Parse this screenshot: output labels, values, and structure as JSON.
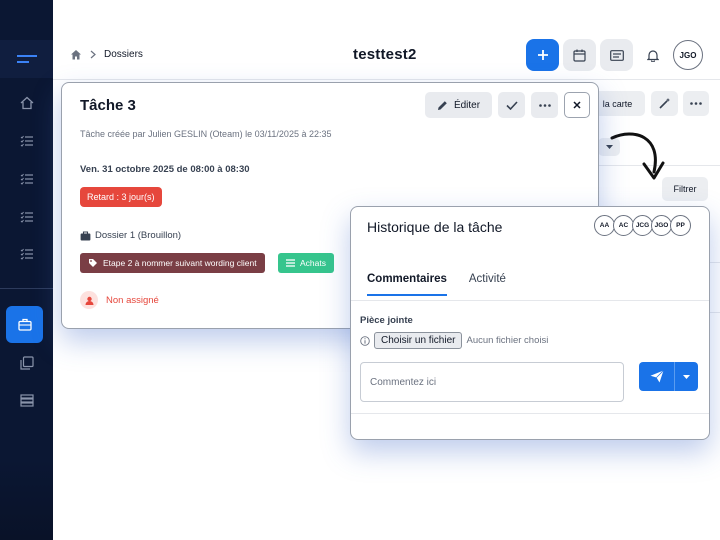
{
  "header": {
    "breadcrumb": "Dossiers",
    "title": "testtest2",
    "avatar": "JGO"
  },
  "background": {
    "card_button": "la carte",
    "filter_button": "Filtrer"
  },
  "task": {
    "title": "Tâche 3",
    "edit_label": "Éditer",
    "created": "Tâche créée par Julien GESLIN (Oteam) le 03/11/2025 à 22:35",
    "date": "Ven. 31 octobre 2025 de 08:00 à 08:30",
    "late_badge": "Retard : 3 jour(s)",
    "folder": "Dossier 1 (Brouillon)",
    "stage_chip": "Etape 2 à nommer suivant wording client",
    "category_chip": "Achats",
    "unassigned": "Non assigné"
  },
  "history": {
    "title": "Historique de la tâche",
    "avatars": [
      "AA",
      "AC",
      "JCG",
      "JGO",
      "PP"
    ],
    "tabs": [
      "Commentaires",
      "Activité"
    ],
    "attachment_label": "Pièce jointe",
    "file_button": "Choisir un fichier",
    "no_file": "Aucun fichier choisi",
    "comment_placeholder": "Commentez ici"
  },
  "colors": {
    "sidebar": "#0b1733",
    "accent": "#1a73e8",
    "danger": "#e6473c",
    "stage_chip": "#7a3e45",
    "category_chip": "#36c58d"
  }
}
